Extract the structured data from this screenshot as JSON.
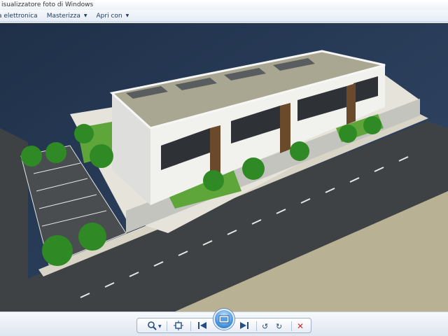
{
  "window": {
    "title": "isualizzatore foto di Windows"
  },
  "menu": {
    "items": [
      {
        "label": "a elettronica",
        "has_dropdown": false
      },
      {
        "label": "Masterizza",
        "has_dropdown": true
      },
      {
        "label": "Apri con",
        "has_dropdown": true
      }
    ]
  },
  "toolbar": {
    "buttons": [
      {
        "name": "zoom-button",
        "icon": "magnifier-icon",
        "has_dropdown": true
      },
      {
        "name": "actual-size-button",
        "icon": "fit-icon"
      },
      {
        "name": "previous-button",
        "icon": "previous-icon"
      },
      {
        "name": "slideshow-button",
        "icon": "slideshow-icon"
      },
      {
        "name": "next-button",
        "icon": "next-icon"
      },
      {
        "name": "rotate-left-button",
        "icon": "rotate-counterclockwise-icon"
      },
      {
        "name": "rotate-right-button",
        "icon": "rotate-clockwise-icon"
      },
      {
        "name": "delete-button",
        "icon": "delete-x-icon"
      }
    ],
    "accent": "#2a5ea8",
    "delete_color": "#d12a2a"
  },
  "image": {
    "subject": "3D architectural render of row houses",
    "colors": {
      "ground": "#2b3e57",
      "road": "#3f4244",
      "plot": "#b8b194",
      "pavement": "#d8d4c6",
      "walls": "#f1f1ee",
      "roof": "#a9a692",
      "fence": "#c4c4bf",
      "grass": "#5fa63a",
      "trees": "#2f8a25"
    }
  }
}
